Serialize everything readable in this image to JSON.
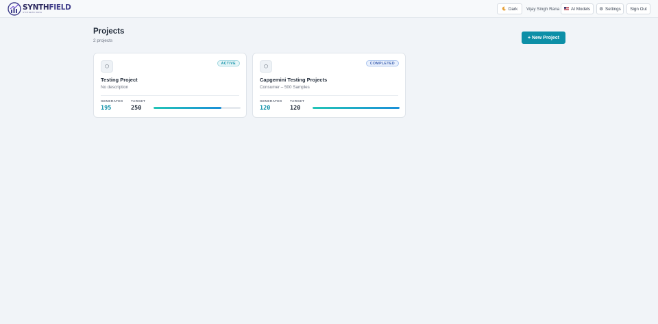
{
  "brand": {
    "name_part1": "SYNTH",
    "name_part2": "FIELD",
    "tagline": "SYNTHETIC DATA"
  },
  "header": {
    "theme_toggle": {
      "icon": "moon-icon",
      "label": "Dark"
    },
    "user_name": "Vijay Singh Rana",
    "ai_models": {
      "icon": "flag-icon",
      "label": "AI Models"
    },
    "settings": {
      "icon": "gear-icon",
      "label": "Settings"
    },
    "sign_out": "Sign Out"
  },
  "page": {
    "title": "Projects",
    "count": "2 projects",
    "new_button": "+ New Project"
  },
  "projects": [
    {
      "icon": "hexagon-icon",
      "status": "ACTIVE",
      "name": "Testing Project",
      "description": "No description",
      "generated_label": "GENERATED",
      "generated": "195",
      "target_label": "TARGET",
      "target": "250",
      "progress": 0.78
    },
    {
      "icon": "hexagon-icon",
      "status": "COMPLETED",
      "name": "Capgemini Testing Projects",
      "description": "Consumer – 500 Samples",
      "generated_label": "GENERATED",
      "generated": "120",
      "target_label": "TARGET",
      "target": "120",
      "progress": 1.0
    }
  ],
  "colors": {
    "accent": "#0d8fa7",
    "background": "#f1f4f8",
    "brand": "#2d2a5f"
  }
}
